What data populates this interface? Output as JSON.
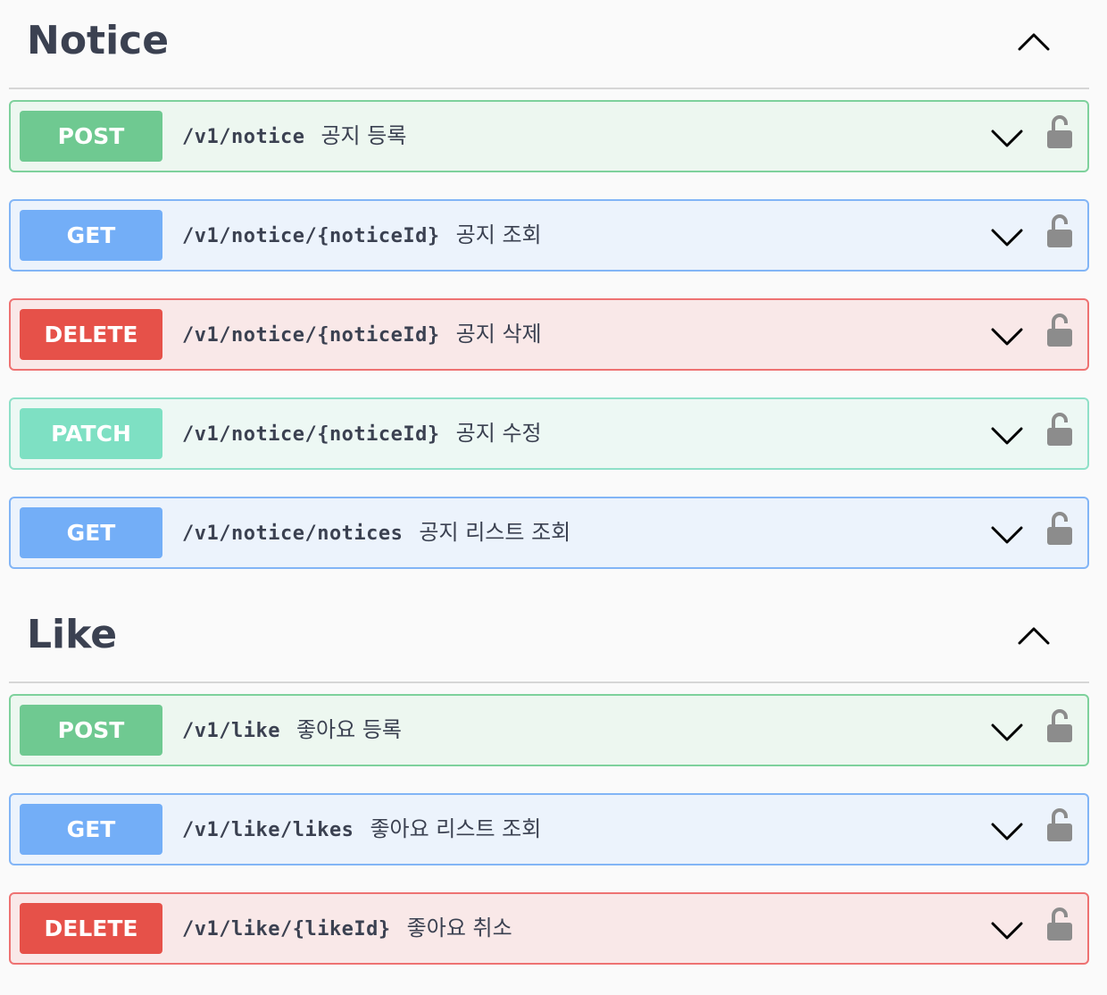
{
  "sections": [
    {
      "title": "Notice",
      "operations": [
        {
          "method": "POST",
          "path": "/v1/notice",
          "summary": "공지 등록"
        },
        {
          "method": "GET",
          "path": "/v1/notice/{noticeId}",
          "summary": "공지 조회"
        },
        {
          "method": "DELETE",
          "path": "/v1/notice/{noticeId}",
          "summary": "공지 삭제"
        },
        {
          "method": "PATCH",
          "path": "/v1/notice/{noticeId}",
          "summary": "공지 수정"
        },
        {
          "method": "GET",
          "path": "/v1/notice/notices",
          "summary": "공지 리스트 조회"
        }
      ]
    },
    {
      "title": "Like",
      "operations": [
        {
          "method": "POST",
          "path": "/v1/like",
          "summary": "좋아요 등록"
        },
        {
          "method": "GET",
          "path": "/v1/like/likes",
          "summary": "좋아요 리스트 조회"
        },
        {
          "method": "DELETE",
          "path": "/v1/like/{likeId}",
          "summary": "좋아요 취소"
        }
      ]
    }
  ],
  "icons": {
    "section_toggle": "chevron-up-icon",
    "operation_toggle": "chevron-down-icon",
    "authorization": "unlocked-padlock-icon"
  },
  "colors": {
    "post": "#6fc991",
    "get": "#73aef7",
    "delete": "#e65149",
    "patch": "#7ee0c3",
    "lock": "#8c8c8c"
  }
}
